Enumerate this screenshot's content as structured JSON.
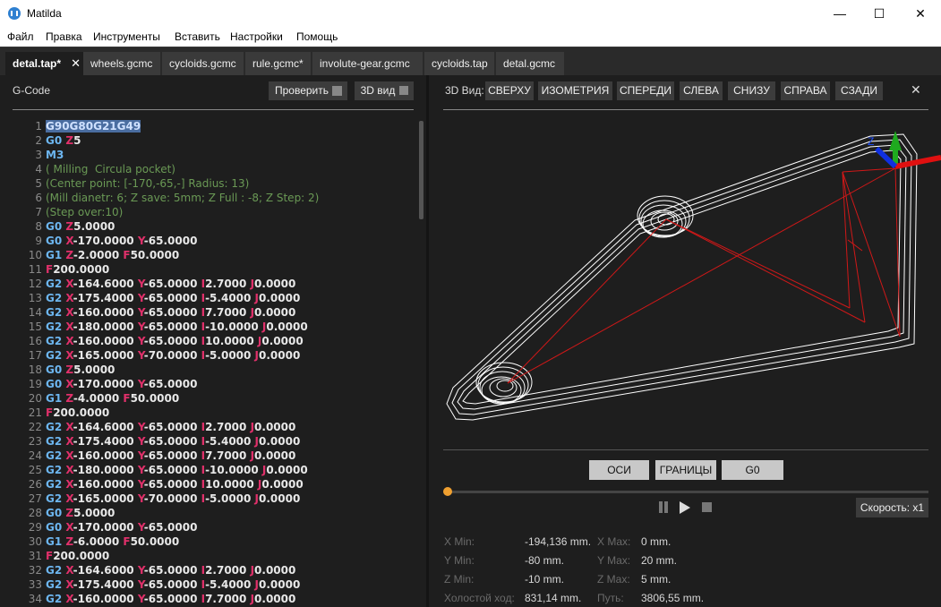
{
  "window": {
    "title": "Matilda",
    "minimize": "—",
    "maximize": "☐",
    "close": "✕"
  },
  "menu": [
    "Файл",
    "Правка",
    "Инструменты",
    "Вставить",
    "Настройки",
    "Помощь"
  ],
  "tabs": [
    "detal.tap*",
    "wheels.gcmc",
    "cycloids.gcmc",
    "rule.gcmc*",
    "involute-gear.gcmc",
    "cycloids.tap",
    "detal.gcmc"
  ],
  "tab_close": "✕",
  "left": {
    "title": "G-Code",
    "check_label": "Проверить",
    "view3d_label": "3D вид"
  },
  "right": {
    "title": "3D Вид:",
    "views": [
      "СВЕРХУ",
      "ИЗОМЕТРИЯ",
      "СПЕРЕДИ",
      "СЛЕВА",
      "СНИЗУ",
      "СПРАВА",
      "СЗАДИ"
    ],
    "close": "✕",
    "toggles": [
      "ОСИ",
      "ГРАНИЦЫ",
      "G0"
    ],
    "speed_label": "Скорость: x1",
    "axis_labels": {
      "z": "Z",
      "y": "Y",
      "x": "X"
    },
    "stats": {
      "xmin_label": "X Min:",
      "xmin": "-194,136 mm.",
      "xmax_label": "X Max:",
      "xmax": "0 mm.",
      "ymin_label": "Y Min:",
      "ymin": "-80 mm.",
      "ymax_label": "Y Max:",
      "ymax": "20 mm.",
      "zmin_label": "Z Min:",
      "zmin": "-10 mm.",
      "zmax_label": "Z Max:",
      "zmax": "5 mm.",
      "idle_label": "Холостой ход:",
      "idle": "831,14 mm.",
      "path_label": "Путь:",
      "path": "3806,55 mm."
    }
  },
  "code_lines": [
    [
      {
        "t": "G90G80G21G49",
        "c": "sel"
      }
    ],
    [
      {
        "t": "G0 ",
        "c": "blue"
      },
      {
        "t": "Z",
        "c": "red"
      },
      {
        "t": "5",
        "c": "white"
      }
    ],
    [
      {
        "t": "M3",
        "c": "blue"
      }
    ],
    [
      {
        "t": "( Milling  Circula pocket)",
        "c": "comment"
      }
    ],
    [
      {
        "t": "(Center point: [-170,-65,-] Radius: 13)",
        "c": "comment"
      }
    ],
    [
      {
        "t": "(Mill dianetr: 6; Z save: 5mm; Z Full : -8; Z Step: 2)",
        "c": "comment"
      }
    ],
    [
      {
        "t": "(Step over:10)",
        "c": "comment"
      }
    ],
    [
      {
        "t": "G0 ",
        "c": "blue"
      },
      {
        "t": "Z",
        "c": "red"
      },
      {
        "t": "5.0000",
        "c": "white"
      }
    ],
    [
      {
        "t": "G0 ",
        "c": "blue"
      },
      {
        "t": "X",
        "c": "red"
      },
      {
        "t": "-170.0000 ",
        "c": "white"
      },
      {
        "t": "Y",
        "c": "red"
      },
      {
        "t": "-65.0000",
        "c": "white"
      }
    ],
    [
      {
        "t": "G1 ",
        "c": "blue"
      },
      {
        "t": "Z",
        "c": "red"
      },
      {
        "t": "-2.0000 ",
        "c": "white"
      },
      {
        "t": "F",
        "c": "red"
      },
      {
        "t": "50.0000",
        "c": "white"
      }
    ],
    [
      {
        "t": "F",
        "c": "red"
      },
      {
        "t": "200.0000",
        "c": "white"
      }
    ],
    [
      {
        "t": "G2 ",
        "c": "blue"
      },
      {
        "t": "X",
        "c": "red"
      },
      {
        "t": "-164.6000 ",
        "c": "white"
      },
      {
        "t": "Y",
        "c": "red"
      },
      {
        "t": "-65.0000 ",
        "c": "white"
      },
      {
        "t": "I",
        "c": "red"
      },
      {
        "t": "2.7000 ",
        "c": "white"
      },
      {
        "t": "J",
        "c": "red"
      },
      {
        "t": "0.0000",
        "c": "white"
      }
    ],
    [
      {
        "t": "G2 ",
        "c": "blue"
      },
      {
        "t": "X",
        "c": "red"
      },
      {
        "t": "-175.4000 ",
        "c": "white"
      },
      {
        "t": "Y",
        "c": "red"
      },
      {
        "t": "-65.0000 ",
        "c": "white"
      },
      {
        "t": "I",
        "c": "red"
      },
      {
        "t": "-5.4000 ",
        "c": "white"
      },
      {
        "t": "J",
        "c": "red"
      },
      {
        "t": "0.0000",
        "c": "white"
      }
    ],
    [
      {
        "t": "G2 ",
        "c": "blue"
      },
      {
        "t": "X",
        "c": "red"
      },
      {
        "t": "-160.0000 ",
        "c": "white"
      },
      {
        "t": "Y",
        "c": "red"
      },
      {
        "t": "-65.0000 ",
        "c": "white"
      },
      {
        "t": "I",
        "c": "red"
      },
      {
        "t": "7.7000 ",
        "c": "white"
      },
      {
        "t": "J",
        "c": "red"
      },
      {
        "t": "0.0000",
        "c": "white"
      }
    ],
    [
      {
        "t": "G2 ",
        "c": "blue"
      },
      {
        "t": "X",
        "c": "red"
      },
      {
        "t": "-180.0000 ",
        "c": "white"
      },
      {
        "t": "Y",
        "c": "red"
      },
      {
        "t": "-65.0000 ",
        "c": "white"
      },
      {
        "t": "I",
        "c": "red"
      },
      {
        "t": "-10.0000 ",
        "c": "white"
      },
      {
        "t": "J",
        "c": "red"
      },
      {
        "t": "0.0000",
        "c": "white"
      }
    ],
    [
      {
        "t": "G2 ",
        "c": "blue"
      },
      {
        "t": "X",
        "c": "red"
      },
      {
        "t": "-160.0000 ",
        "c": "white"
      },
      {
        "t": "Y",
        "c": "red"
      },
      {
        "t": "-65.0000 ",
        "c": "white"
      },
      {
        "t": "I",
        "c": "red"
      },
      {
        "t": "10.0000 ",
        "c": "white"
      },
      {
        "t": "J",
        "c": "red"
      },
      {
        "t": "0.0000",
        "c": "white"
      }
    ],
    [
      {
        "t": "G2 ",
        "c": "blue"
      },
      {
        "t": "X",
        "c": "red"
      },
      {
        "t": "-165.0000 ",
        "c": "white"
      },
      {
        "t": "Y",
        "c": "red"
      },
      {
        "t": "-70.0000 ",
        "c": "white"
      },
      {
        "t": "I",
        "c": "red"
      },
      {
        "t": "-5.0000 ",
        "c": "white"
      },
      {
        "t": "J",
        "c": "red"
      },
      {
        "t": "0.0000",
        "c": "white"
      }
    ],
    [
      {
        "t": "G0 ",
        "c": "blue"
      },
      {
        "t": "Z",
        "c": "red"
      },
      {
        "t": "5.0000",
        "c": "white"
      }
    ],
    [
      {
        "t": "G0 ",
        "c": "blue"
      },
      {
        "t": "X",
        "c": "red"
      },
      {
        "t": "-170.0000 ",
        "c": "white"
      },
      {
        "t": "Y",
        "c": "red"
      },
      {
        "t": "-65.0000",
        "c": "white"
      }
    ],
    [
      {
        "t": "G1 ",
        "c": "blue"
      },
      {
        "t": "Z",
        "c": "red"
      },
      {
        "t": "-4.0000 ",
        "c": "white"
      },
      {
        "t": "F",
        "c": "red"
      },
      {
        "t": "50.0000",
        "c": "white"
      }
    ],
    [
      {
        "t": "F",
        "c": "red"
      },
      {
        "t": "200.0000",
        "c": "white"
      }
    ],
    [
      {
        "t": "G2 ",
        "c": "blue"
      },
      {
        "t": "X",
        "c": "red"
      },
      {
        "t": "-164.6000 ",
        "c": "white"
      },
      {
        "t": "Y",
        "c": "red"
      },
      {
        "t": "-65.0000 ",
        "c": "white"
      },
      {
        "t": "I",
        "c": "red"
      },
      {
        "t": "2.7000 ",
        "c": "white"
      },
      {
        "t": "J",
        "c": "red"
      },
      {
        "t": "0.0000",
        "c": "white"
      }
    ],
    [
      {
        "t": "G2 ",
        "c": "blue"
      },
      {
        "t": "X",
        "c": "red"
      },
      {
        "t": "-175.4000 ",
        "c": "white"
      },
      {
        "t": "Y",
        "c": "red"
      },
      {
        "t": "-65.0000 ",
        "c": "white"
      },
      {
        "t": "I",
        "c": "red"
      },
      {
        "t": "-5.4000 ",
        "c": "white"
      },
      {
        "t": "J",
        "c": "red"
      },
      {
        "t": "0.0000",
        "c": "white"
      }
    ],
    [
      {
        "t": "G2 ",
        "c": "blue"
      },
      {
        "t": "X",
        "c": "red"
      },
      {
        "t": "-160.0000 ",
        "c": "white"
      },
      {
        "t": "Y",
        "c": "red"
      },
      {
        "t": "-65.0000 ",
        "c": "white"
      },
      {
        "t": "I",
        "c": "red"
      },
      {
        "t": "7.7000 ",
        "c": "white"
      },
      {
        "t": "J",
        "c": "red"
      },
      {
        "t": "0.0000",
        "c": "white"
      }
    ],
    [
      {
        "t": "G2 ",
        "c": "blue"
      },
      {
        "t": "X",
        "c": "red"
      },
      {
        "t": "-180.0000 ",
        "c": "white"
      },
      {
        "t": "Y",
        "c": "red"
      },
      {
        "t": "-65.0000 ",
        "c": "white"
      },
      {
        "t": "I",
        "c": "red"
      },
      {
        "t": "-10.0000 ",
        "c": "white"
      },
      {
        "t": "J",
        "c": "red"
      },
      {
        "t": "0.0000",
        "c": "white"
      }
    ],
    [
      {
        "t": "G2 ",
        "c": "blue"
      },
      {
        "t": "X",
        "c": "red"
      },
      {
        "t": "-160.0000 ",
        "c": "white"
      },
      {
        "t": "Y",
        "c": "red"
      },
      {
        "t": "-65.0000 ",
        "c": "white"
      },
      {
        "t": "I",
        "c": "red"
      },
      {
        "t": "10.0000 ",
        "c": "white"
      },
      {
        "t": "J",
        "c": "red"
      },
      {
        "t": "0.0000",
        "c": "white"
      }
    ],
    [
      {
        "t": "G2 ",
        "c": "blue"
      },
      {
        "t": "X",
        "c": "red"
      },
      {
        "t": "-165.0000 ",
        "c": "white"
      },
      {
        "t": "Y",
        "c": "red"
      },
      {
        "t": "-70.0000 ",
        "c": "white"
      },
      {
        "t": "I",
        "c": "red"
      },
      {
        "t": "-5.0000 ",
        "c": "white"
      },
      {
        "t": "J",
        "c": "red"
      },
      {
        "t": "0.0000",
        "c": "white"
      }
    ],
    [
      {
        "t": "G0 ",
        "c": "blue"
      },
      {
        "t": "Z",
        "c": "red"
      },
      {
        "t": "5.0000",
        "c": "white"
      }
    ],
    [
      {
        "t": "G0 ",
        "c": "blue"
      },
      {
        "t": "X",
        "c": "red"
      },
      {
        "t": "-170.0000 ",
        "c": "white"
      },
      {
        "t": "Y",
        "c": "red"
      },
      {
        "t": "-65.0000",
        "c": "white"
      }
    ],
    [
      {
        "t": "G1 ",
        "c": "blue"
      },
      {
        "t": "Z",
        "c": "red"
      },
      {
        "t": "-6.0000 ",
        "c": "white"
      },
      {
        "t": "F",
        "c": "red"
      },
      {
        "t": "50.0000",
        "c": "white"
      }
    ],
    [
      {
        "t": "F",
        "c": "red"
      },
      {
        "t": "200.0000",
        "c": "white"
      }
    ],
    [
      {
        "t": "G2 ",
        "c": "blue"
      },
      {
        "t": "X",
        "c": "red"
      },
      {
        "t": "-164.6000 ",
        "c": "white"
      },
      {
        "t": "Y",
        "c": "red"
      },
      {
        "t": "-65.0000 ",
        "c": "white"
      },
      {
        "t": "I",
        "c": "red"
      },
      {
        "t": "2.7000 ",
        "c": "white"
      },
      {
        "t": "J",
        "c": "red"
      },
      {
        "t": "0.0000",
        "c": "white"
      }
    ],
    [
      {
        "t": "G2 ",
        "c": "blue"
      },
      {
        "t": "X",
        "c": "red"
      },
      {
        "t": "-175.4000 ",
        "c": "white"
      },
      {
        "t": "Y",
        "c": "red"
      },
      {
        "t": "-65.0000 ",
        "c": "white"
      },
      {
        "t": "I",
        "c": "red"
      },
      {
        "t": "-5.4000 ",
        "c": "white"
      },
      {
        "t": "J",
        "c": "red"
      },
      {
        "t": "0.0000",
        "c": "white"
      }
    ],
    [
      {
        "t": "G2 ",
        "c": "blue"
      },
      {
        "t": "X",
        "c": "red"
      },
      {
        "t": "-160.0000 ",
        "c": "white"
      },
      {
        "t": "Y",
        "c": "red"
      },
      {
        "t": "-65.0000 ",
        "c": "white"
      },
      {
        "t": "I",
        "c": "red"
      },
      {
        "t": "7.7000 ",
        "c": "white"
      },
      {
        "t": "J",
        "c": "red"
      },
      {
        "t": "0.0000",
        "c": "white"
      }
    ]
  ]
}
